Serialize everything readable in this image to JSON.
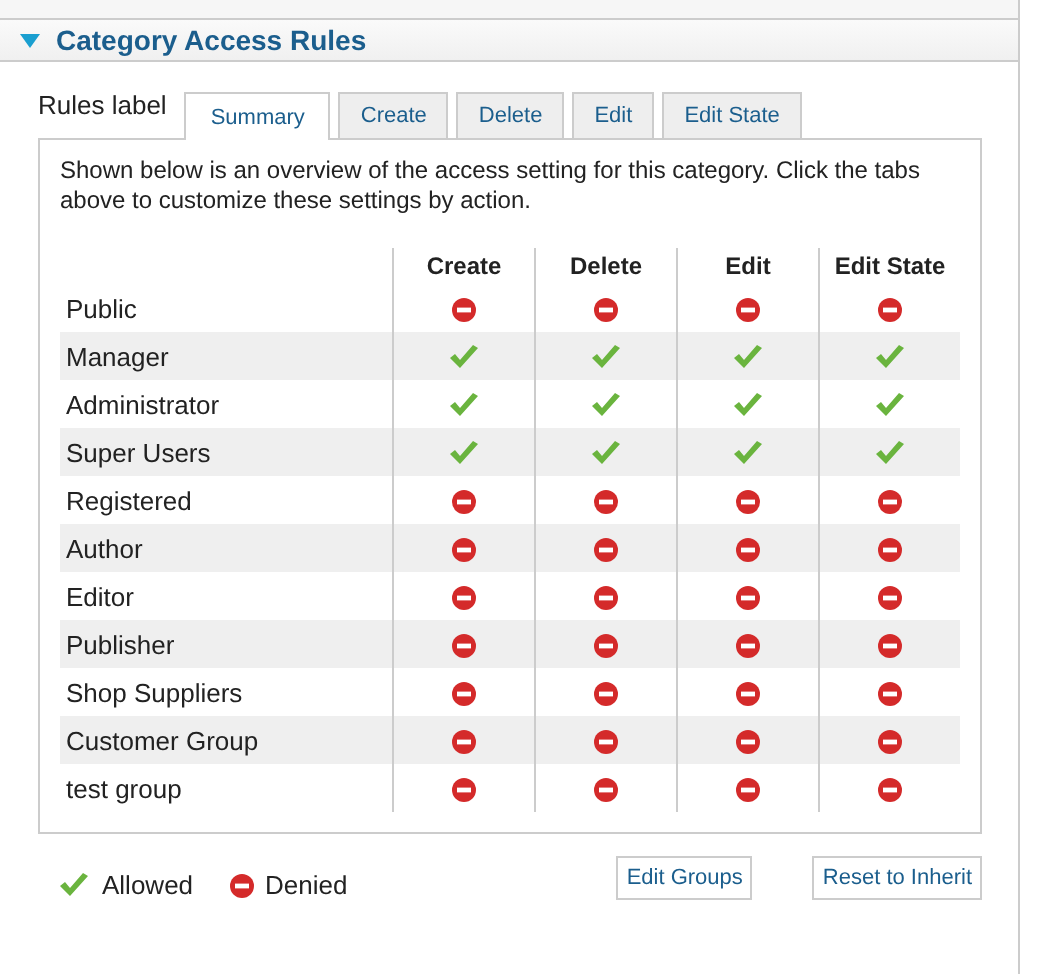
{
  "panel": {
    "title": "Category Access Rules",
    "expanded": true
  },
  "rules_label": "Rules label",
  "tabs": [
    {
      "label": "Summary",
      "selected": true
    },
    {
      "label": "Create",
      "selected": false
    },
    {
      "label": "Delete",
      "selected": false
    },
    {
      "label": "Edit",
      "selected": false
    },
    {
      "label": "Edit State",
      "selected": false
    }
  ],
  "description": "Shown below is an overview of the access setting for this category. Click the tabs above to customize these settings by action.",
  "table": {
    "columns": [
      "Create",
      "Delete",
      "Edit",
      "Edit State"
    ],
    "rows": [
      {
        "group": "Public",
        "allowed": [
          false,
          false,
          false,
          false
        ]
      },
      {
        "group": "Manager",
        "allowed": [
          true,
          true,
          true,
          true
        ]
      },
      {
        "group": "Administrator",
        "allowed": [
          true,
          true,
          true,
          true
        ]
      },
      {
        "group": "Super Users",
        "allowed": [
          true,
          true,
          true,
          true
        ]
      },
      {
        "group": "Registered",
        "allowed": [
          false,
          false,
          false,
          false
        ]
      },
      {
        "group": "Author",
        "allowed": [
          false,
          false,
          false,
          false
        ]
      },
      {
        "group": "Editor",
        "allowed": [
          false,
          false,
          false,
          false
        ]
      },
      {
        "group": "Publisher",
        "allowed": [
          false,
          false,
          false,
          false
        ]
      },
      {
        "group": "Shop Suppliers",
        "allowed": [
          false,
          false,
          false,
          false
        ]
      },
      {
        "group": "Customer Group",
        "allowed": [
          false,
          false,
          false,
          false
        ]
      },
      {
        "group": "test group",
        "allowed": [
          false,
          false,
          false,
          false
        ]
      }
    ]
  },
  "legend": {
    "allowed": "Allowed",
    "denied": "Denied"
  },
  "buttons": [
    "Edit Groups",
    "Reset to Inherit"
  ]
}
